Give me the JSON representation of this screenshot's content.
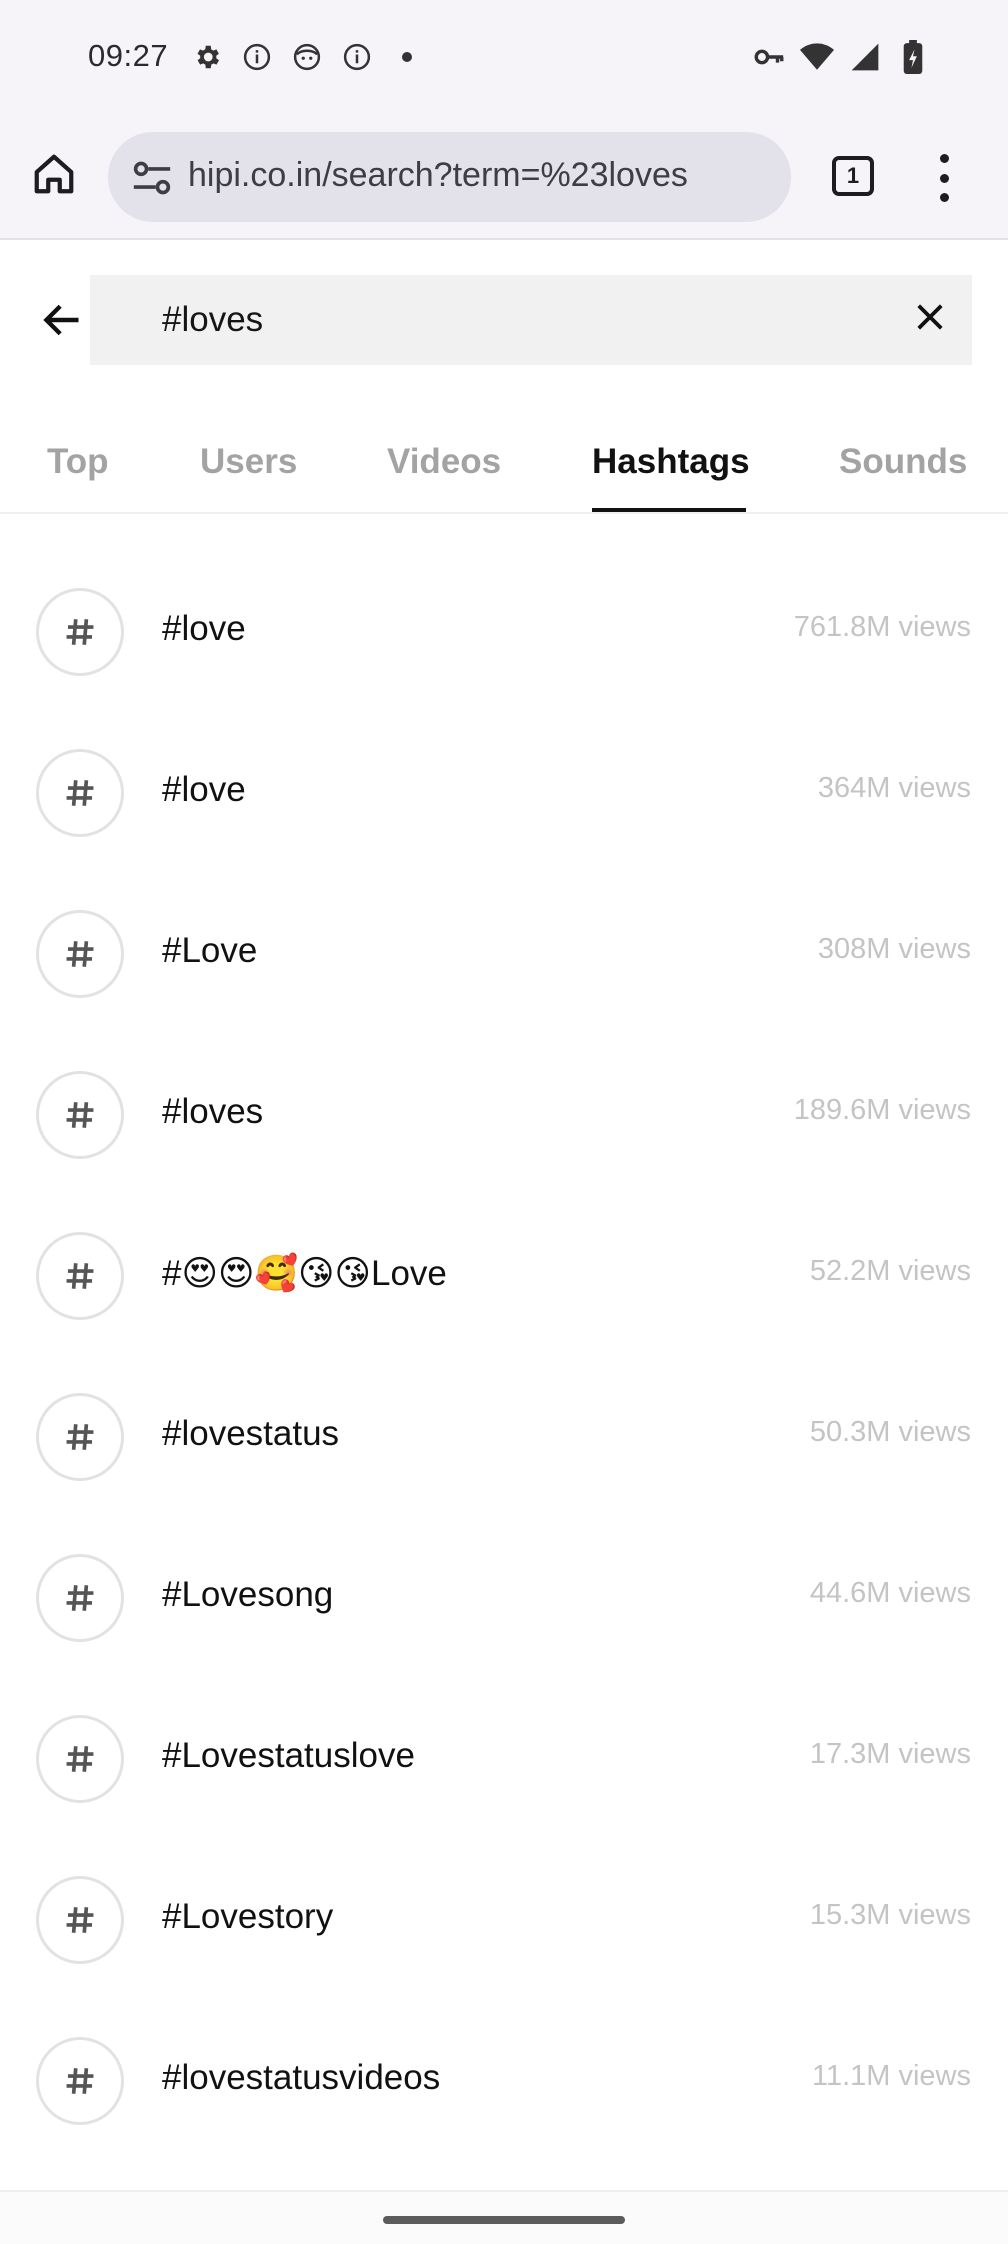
{
  "status_bar": {
    "time": "09:27",
    "left_icons": [
      "settings-icon",
      "info-icon",
      "face-icon",
      "info-icon",
      "dot-icon"
    ],
    "right_icons": [
      "key-icon",
      "wifi-icon",
      "signal-icon",
      "battery-icon"
    ]
  },
  "browser": {
    "url": "hipi.co.in/search?term=%23loves",
    "tab_count": "1"
  },
  "search": {
    "query": "#loves"
  },
  "tabs": [
    {
      "label": "Top",
      "active": false
    },
    {
      "label": "Users",
      "active": false
    },
    {
      "label": "Videos",
      "active": false
    },
    {
      "label": "Hashtags",
      "active": true
    },
    {
      "label": "Sounds",
      "active": false
    }
  ],
  "hashtags": [
    {
      "name": "#love",
      "views": "761.8M views"
    },
    {
      "name": "#love",
      "views": "364M views"
    },
    {
      "name": "#Love",
      "views": "308M views"
    },
    {
      "name": "#loves",
      "views": "189.6M views"
    },
    {
      "name": "#😍😍🥰😘😘Love",
      "views": "52.2M views"
    },
    {
      "name": "#lovestatus",
      "views": "50.3M views"
    },
    {
      "name": "#Lovesong",
      "views": "44.6M views"
    },
    {
      "name": "#Lovestatuslove",
      "views": "17.3M views"
    },
    {
      "name": "#Lovestory",
      "views": "15.3M views"
    },
    {
      "name": "#lovestatusvideos",
      "views": "11.1M views"
    }
  ],
  "colors": {
    "active_tab": "#111111",
    "inactive_tab": "#a3a3a3",
    "views_text": "#c4c4c4",
    "chrome_bg": "#f6f3f9"
  }
}
